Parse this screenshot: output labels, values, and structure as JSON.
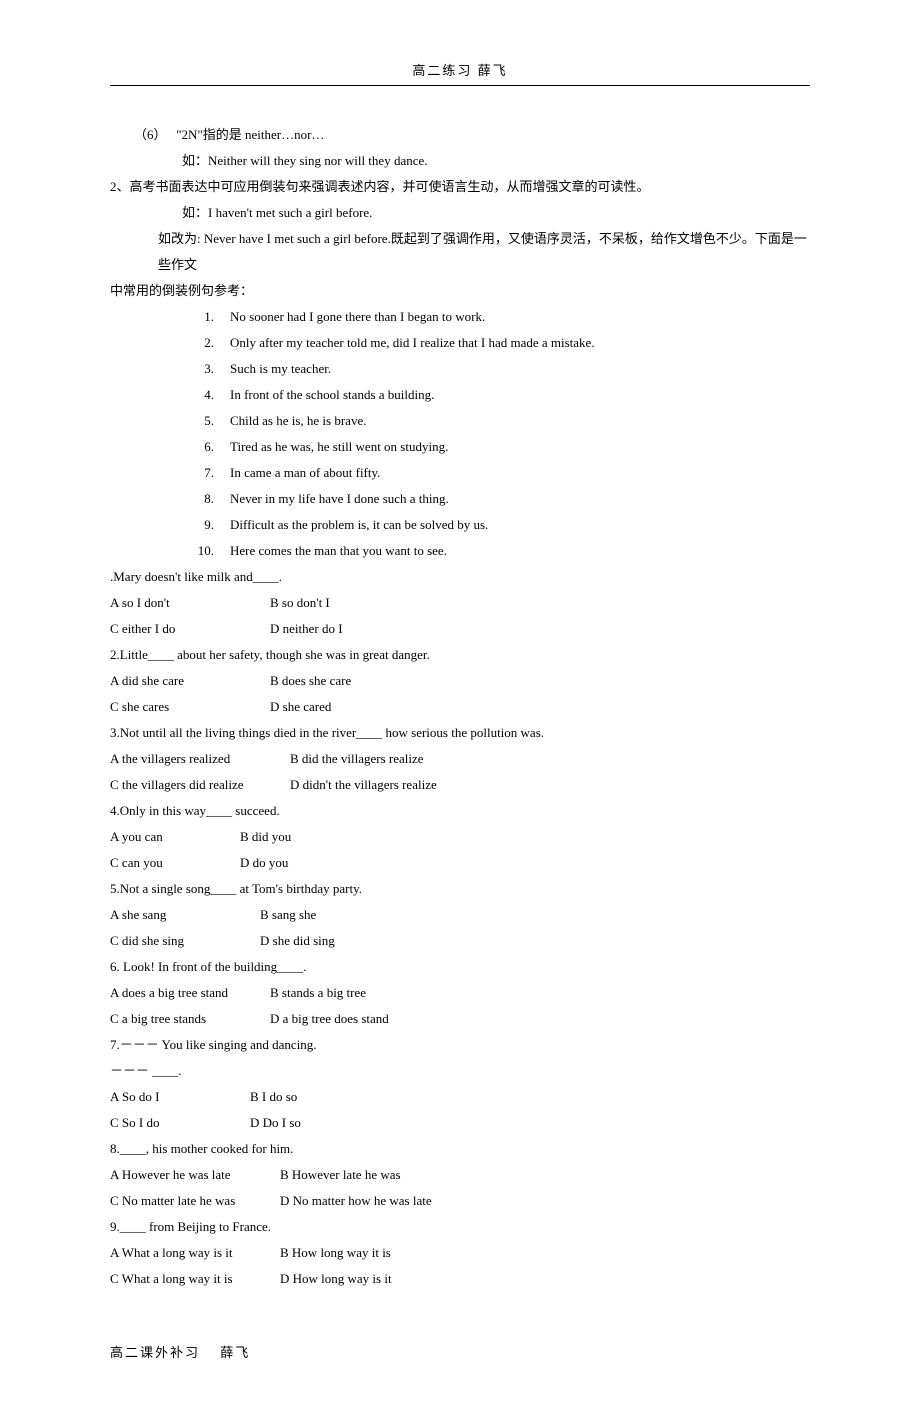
{
  "header": "高二练习   薛飞",
  "sec6": {
    "label": "（6）　  \"2N\"指的是 neither…nor…",
    "ex_label": "如：Neither will they sing nor will they dance."
  },
  "sec2": {
    "text": "2、高考书面表达中可应用倒装句来强调表述内容，并可使语言生动，从而增强文章的可读性。",
    "ex_label": "如：I haven't met such a girl before.",
    "rewrite": "如改为: Never have I met such a girl before.既起到了强调作用，又使语序灵活，不呆板，给作文增色不少。下面是一些作文",
    "rewrite2": "中常用的倒装例句参考："
  },
  "examples": [
    "No sooner had I gone there than I began to work.",
    "Only after my teacher told me, did I realize that I had made a mistake.",
    "Such is my teacher.",
    "In front of the school stands a building.",
    "Child as he is, he is brave.",
    "Tired as he was, he still went on studying.",
    "In came a man of about fifty.",
    "Never in my life have I done such a thing.",
    "Difficult as the problem is, it can be solved by us.",
    "Here comes the man that you want to see."
  ],
  "q1": {
    "stem": ".Mary doesn't like milk and____.",
    "a": "A so I don't",
    "b": "B so don't I",
    "c": "C either I do",
    "d": "D neither do I"
  },
  "q2": {
    "stem": "2.Little____ about her safety, though she was in great danger.",
    "a": "A did she care",
    "b": "B does she care",
    "c": "C she cares",
    "d": "D she cared"
  },
  "q3": {
    "stem": "3.Not until all the living things died in the river____ how serious the pollution was.",
    "a": "A the villagers realized",
    "b": "B did the villagers realize",
    "c": "C the villagers did realize",
    "d": "D didn't the villagers realize"
  },
  "q4": {
    "stem": "4.Only in this way____ succeed.",
    "a": "A you can",
    "b": "B did you",
    "c": "C can you",
    "d": "D do you"
  },
  "q5": {
    "stem": "5.Not a single song____ at Tom's birthday party.",
    "a": "A she sang",
    "b": "B sang she",
    "c": "C did she sing",
    "d": "D she did sing"
  },
  "q6": {
    "stem": "6. Look! In front of the building____.",
    "a": "A does a big tree stand",
    "b": "B stands a big tree",
    "c": "C a big tree stands",
    "d": "D a big tree does stand"
  },
  "q7": {
    "stem": "7.－－－  You like singing and dancing.",
    "stem2": "   －－－   ____.",
    "a": "A So do I",
    "b": "B I do so",
    "c": "C So I do",
    "d": "D Do I so"
  },
  "q8": {
    "stem": "8.____, his mother cooked for him.",
    "a": "A However he was late",
    "b": "B However late he was",
    "c": "C No matter late he was",
    "d": "D No matter how he was late"
  },
  "q9": {
    "stem": "9.____ from Beijing to France.",
    "a": "A What a long way is it",
    "b": "B How long way it is",
    "c": "C What a long way it is",
    "d": "D How long way is it"
  },
  "footer": "高二课外补习　 薛飞"
}
